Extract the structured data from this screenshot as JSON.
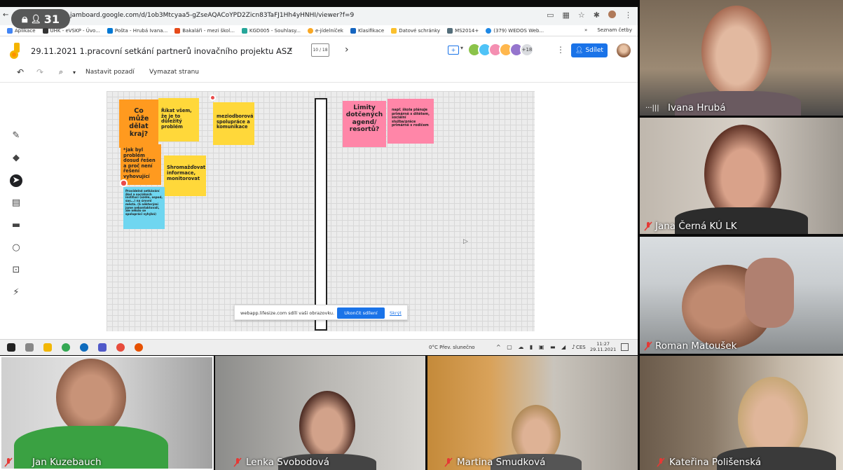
{
  "recording_pill": {
    "label": "31"
  },
  "browser": {
    "url": "jamboard.google.com/d/1ob3Mtcyaa5-gZseAQACoYPD2Zicn83TaFJ1Hh4yHNHI/viewer?f=9",
    "bookmarks": [
      "Aplikace",
      "UHK - eVSKP - Úvo...",
      "Pošta - Hrubá Ivana...",
      "Bakaláři - mezi škol...",
      "KGD005 - Souhlasy...",
      "e-jídelníček",
      "Klasifikace",
      "Datové schránky",
      "MS2014+",
      "(379) WEDOS Web..."
    ],
    "bookmark_more": "»",
    "reading_list": "Seznam četby"
  },
  "jamboard": {
    "title": "29.11.2021 1.pracovní setkání partnerů inovačního projektu ASZ",
    "frame_indicator": "10 / 18",
    "collaborators_more": "+18",
    "share_label": "Sdílet",
    "set_background": "Nastavit pozadí",
    "clear_frame": "Vymazat stranu",
    "notes": {
      "co_muze": "Co může dělat kraj?",
      "rikat": "Říkat všem, že je to důležitý problém",
      "meziodborova": "meziodborová spolupráce a komunikace",
      "jak_byl": "*jak byl problém dosud řešen a proč není řešení vyhovující",
      "shromazdovat": "Shromažďovat informace, monitorovat",
      "pravidelne": "Pravidelné setkávání škol a sociálních institucí (ozdm, ospod, sas...) na úrovni města. (S některými jsme nekontaktovali, ale někdo se spolupráci vyhýbá)",
      "limity": "Limity dotčených agend/ resortů?",
      "napr": "např. škola plánuje primárně s dítětem, sociální služba/práce primárně s rodičem"
    }
  },
  "share_notice": {
    "text": "webapp.lifesize.com sdílí vaši obrazovku.",
    "stop": "Ukončit sdílení",
    "hide": "Skrýt"
  },
  "taskbar": {
    "weather": "0°C Přev. slunečno",
    "lang": "CES",
    "time": "11:27",
    "date": "29.11.2021"
  },
  "participants": [
    {
      "name": "Ivana Hrubá",
      "speaking": true
    },
    {
      "name": "Jana Černá KÚ LK",
      "muted": true
    },
    {
      "name": "Roman Matoušek",
      "muted": true
    },
    {
      "name": "Jan Kuzebauch",
      "muted": true
    },
    {
      "name": "Lenka Svobodová",
      "muted": true
    },
    {
      "name": "Martina Smudková",
      "muted": true
    },
    {
      "name": "Kateřina Polišenská",
      "muted": true
    }
  ]
}
